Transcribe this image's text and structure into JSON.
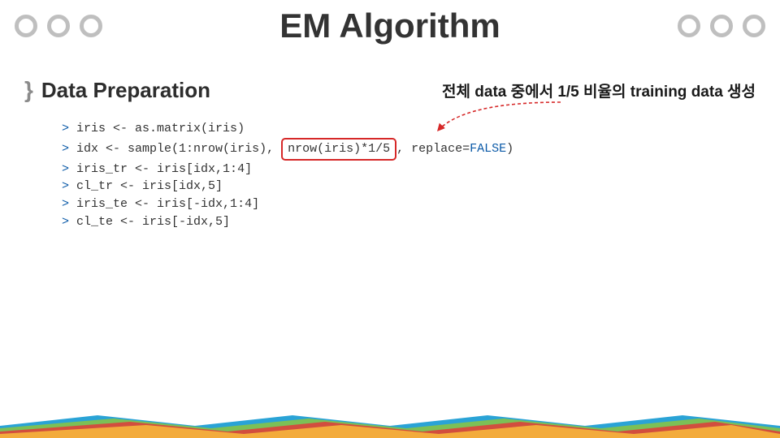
{
  "title": "EM Algorithm",
  "bullet_glyph": "}",
  "section": "Data Preparation",
  "annotation": "전체 data 중에서 1/5 비율의 training data 생성",
  "prompt": ">",
  "code": {
    "0": "iris <- as.matrix(iris)",
    "1_a": "idx <- sample(1:nrow(iris), ",
    "1_hl": "nrow(iris)*1/5",
    "1_b": ", replace=",
    "1_kw": "FALSE",
    "1_c": ")",
    "2": "iris_tr <- iris[idx,1:4]",
    "3": "cl_tr <- iris[idx,5]",
    "4": "iris_te <- iris[-idx,1:4]",
    "5": "cl_te <- iris[-idx,5]"
  }
}
